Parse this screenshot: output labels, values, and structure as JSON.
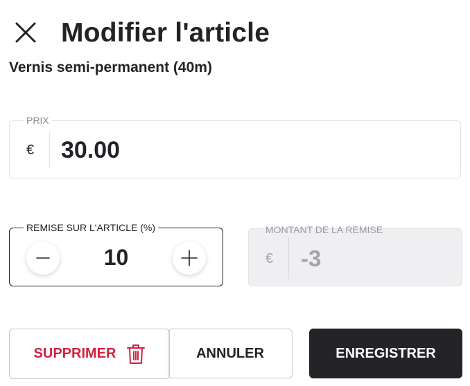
{
  "header": {
    "title": "Modifier l'article",
    "close_icon": "close-icon"
  },
  "item": {
    "name": "Vernis semi-permanent (40m)"
  },
  "price": {
    "label": "PRIX",
    "currency": "€",
    "value": "30.00"
  },
  "discount": {
    "label": "REMISE SUR L'ARTICLE (%)",
    "value": "10",
    "decrement_icon": "minus-icon",
    "increment_icon": "plus-icon"
  },
  "discount_amount": {
    "label": "MONTANT DE LA REMISE",
    "currency": "€",
    "value": "-3"
  },
  "actions": {
    "delete_label": "SUPPRIMER",
    "delete_icon": "trash-icon",
    "cancel_label": "ANNULER",
    "save_label": "ENREGISTRER"
  },
  "colors": {
    "danger": "#d0213f",
    "primary_dark": "#242428",
    "disabled_bg": "#efeff1"
  }
}
